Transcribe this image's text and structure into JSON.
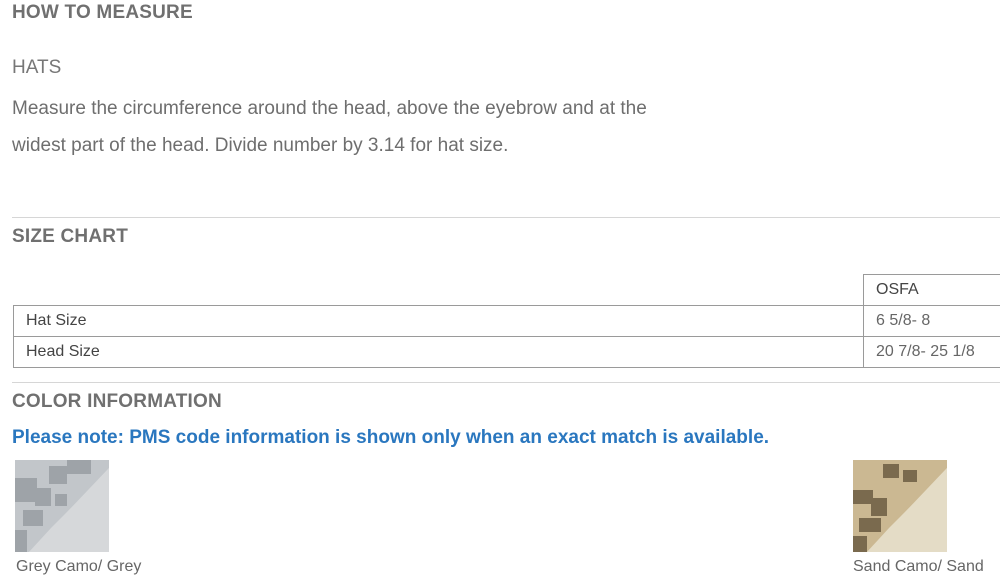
{
  "measure": {
    "heading": "HOW TO MEASURE",
    "subheading": "HATS",
    "line1": "Measure the circumference around the head, above the eyebrow and at the",
    "line2": "widest part of the head. Divide number by 3.14 for hat size."
  },
  "size_chart": {
    "heading": "SIZE CHART",
    "column_header": "OSFA",
    "rows": [
      {
        "label": "Hat Size",
        "value": "6 5/8- 8"
      },
      {
        "label": "Head Size",
        "value": "20 7/8- 25 1/8"
      }
    ]
  },
  "color_info": {
    "heading": "COLOR INFORMATION",
    "note": "Please note: PMS code information is shown only when an exact match is available.",
    "swatches": [
      {
        "label": "Grey Camo/ Grey",
        "colors": [
          "#9ea3a8",
          "#c2c6ca",
          "#d6d8da"
        ]
      },
      {
        "label": "Sand Camo/ Sand",
        "colors": [
          "#7a6a4e",
          "#cbb892",
          "#e4dcc6"
        ]
      }
    ]
  }
}
